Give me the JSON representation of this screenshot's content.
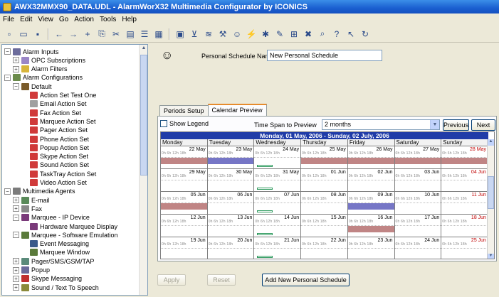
{
  "window": {
    "title": "AWX32MMX90_DATA.UDL - AlarmWorX32 Multimedia Configurator by ICONICS"
  },
  "menu": [
    "File",
    "Edit",
    "View",
    "Go",
    "Action",
    "Tools",
    "Help"
  ],
  "toolbar_icons": [
    "new-icon",
    "open-icon",
    "save-icon",
    "back-icon",
    "forward-icon",
    "add-icon",
    "copy-icon",
    "cut-icon",
    "paste-icon",
    "list-icon",
    "grid-icon",
    "calendar-icon",
    "filter-icon",
    "chart-icon",
    "tools-icon",
    "person-icon",
    "lightning-icon",
    "config-icon",
    "wand-icon",
    "rules-icon",
    "delete-icon",
    "lookup-icon",
    "help-icon",
    "pointer-help-icon",
    "refresh-icon"
  ],
  "tree": {
    "items": [
      {
        "label": "Alarm Inputs",
        "level": 0,
        "exp": "-",
        "color": "#6b6b9b"
      },
      {
        "label": "OPC Subscriptions",
        "level": 1,
        "exp": "+",
        "color": "#9a86c7"
      },
      {
        "label": "Alarm Filters",
        "level": 1,
        "exp": "+",
        "color": "#d7b53b"
      },
      {
        "label": "Alarm Configurations",
        "level": 0,
        "exp": "-",
        "color": "#6b8b4b"
      },
      {
        "label": "Default",
        "level": 1,
        "exp": "-",
        "color": "#7a5b2a"
      },
      {
        "label": "Action Set Test One",
        "level": 2,
        "exp": "",
        "color": "#d03a3a"
      },
      {
        "label": "Email Action Set",
        "level": 2,
        "exp": "",
        "color": "#a0a0a0"
      },
      {
        "label": "Fax Action Set",
        "level": 2,
        "exp": "",
        "color": "#d03a3a"
      },
      {
        "label": "Marquee Action Set",
        "level": 2,
        "exp": "",
        "color": "#d03a3a"
      },
      {
        "label": "Pager Action Set",
        "level": 2,
        "exp": "",
        "color": "#d03a3a"
      },
      {
        "label": "Phone Action Set",
        "level": 2,
        "exp": "",
        "color": "#d03a3a"
      },
      {
        "label": "Popup Action Set",
        "level": 2,
        "exp": "",
        "color": "#d03a3a"
      },
      {
        "label": "Skype Action Set",
        "level": 2,
        "exp": "",
        "color": "#d03a3a"
      },
      {
        "label": "Sound Action Set",
        "level": 2,
        "exp": "",
        "color": "#d03a3a"
      },
      {
        "label": "TaskTray Action Set",
        "level": 2,
        "exp": "",
        "color": "#d03a3a"
      },
      {
        "label": "Video Action Set",
        "level": 2,
        "exp": "",
        "color": "#d03a3a"
      },
      {
        "label": "Multimedia Agents",
        "level": 0,
        "exp": "-",
        "color": "#7b7b7b"
      },
      {
        "label": "E-mail",
        "level": 1,
        "exp": "+",
        "color": "#5a8a5a"
      },
      {
        "label": "Fax",
        "level": 1,
        "exp": "+",
        "color": "#8a8a8a"
      },
      {
        "label": "Marquee - IP Device",
        "level": 1,
        "exp": "-",
        "color": "#7a3a7a"
      },
      {
        "label": "Hardware Marquee Display",
        "level": 2,
        "exp": "",
        "color": "#7a3a7a"
      },
      {
        "label": "Marquee - Software Emulation",
        "level": 1,
        "exp": "-",
        "color": "#5a7a3a"
      },
      {
        "label": "Event Messaging",
        "level": 2,
        "exp": "",
        "color": "#3a5a8a"
      },
      {
        "label": "Marquee Window",
        "level": 2,
        "exp": "",
        "color": "#5a7a3a"
      },
      {
        "label": "Pager/SMS/GSM/TAP",
        "level": 1,
        "exp": "+",
        "color": "#5a8a7a"
      },
      {
        "label": "Popup",
        "level": 1,
        "exp": "+",
        "color": "#6a6a9a"
      },
      {
        "label": "Skype Messaging",
        "level": 1,
        "exp": "+",
        "color": "#c03030"
      },
      {
        "label": "Sound / Text To Speech",
        "level": 1,
        "exp": "+",
        "color": "#8a8a3a"
      }
    ]
  },
  "schedule": {
    "name_label": "Personal Schedule Name",
    "name_value": "New Personal Schedule"
  },
  "tabs": [
    "Periods Setup",
    "Calendar Preview"
  ],
  "preview": {
    "show_legend": "Show Legend",
    "time_span_label": "Time Span to Preview",
    "time_span_value": "2 months",
    "previous": "Previous",
    "next": "Next"
  },
  "calendar": {
    "title": "Monday, 01 May, 2006 - Sunday, 02 July, 2006",
    "days": [
      "Monday",
      "Tuesday",
      "Wednesday",
      "Thursday",
      "Friday",
      "Saturday",
      "Sunday"
    ],
    "hours": "0h 6h 12h 18h",
    "weeks": [
      {
        "dates": [
          "22 May",
          "23 May",
          "24 May",
          "25 May",
          "26 May",
          "27 May",
          "28 May"
        ],
        "bands": [
          "red",
          "blue",
          "",
          "red",
          "red",
          "red",
          "red"
        ]
      },
      {
        "dates": [
          "29 May",
          "30 May",
          "31 May",
          "01 Jun",
          "02 Jun",
          "03 Jun",
          "04 Jun"
        ],
        "bands": [
          "",
          "",
          "",
          "",
          "",
          "",
          ""
        ]
      },
      {
        "dates": [
          "05 Jun",
          "06 Jun",
          "07 Jun",
          "08 Jun",
          "09 Jun",
          "10 Jun",
          "11 Jun"
        ],
        "bands": [
          "red",
          "",
          "",
          "",
          "blue",
          "",
          ""
        ]
      },
      {
        "dates": [
          "12 Jun",
          "13 Jun",
          "14 Jun",
          "15 Jun",
          "16 Jun",
          "17 Jun",
          "18 Jun"
        ],
        "bands": [
          "",
          "",
          "",
          "",
          "red",
          "",
          ""
        ]
      },
      {
        "dates": [
          "19 Jun",
          "20 Jun",
          "21 Jun",
          "22 Jun",
          "23 Jun",
          "24 Jun",
          "25 Jun"
        ],
        "bands": [
          "",
          "",
          "",
          "",
          "",
          "",
          ""
        ]
      }
    ],
    "busy_col": 2
  },
  "buttons": {
    "apply": "Apply",
    "reset": "Reset",
    "add_new": "Add New Personal Schedule"
  }
}
